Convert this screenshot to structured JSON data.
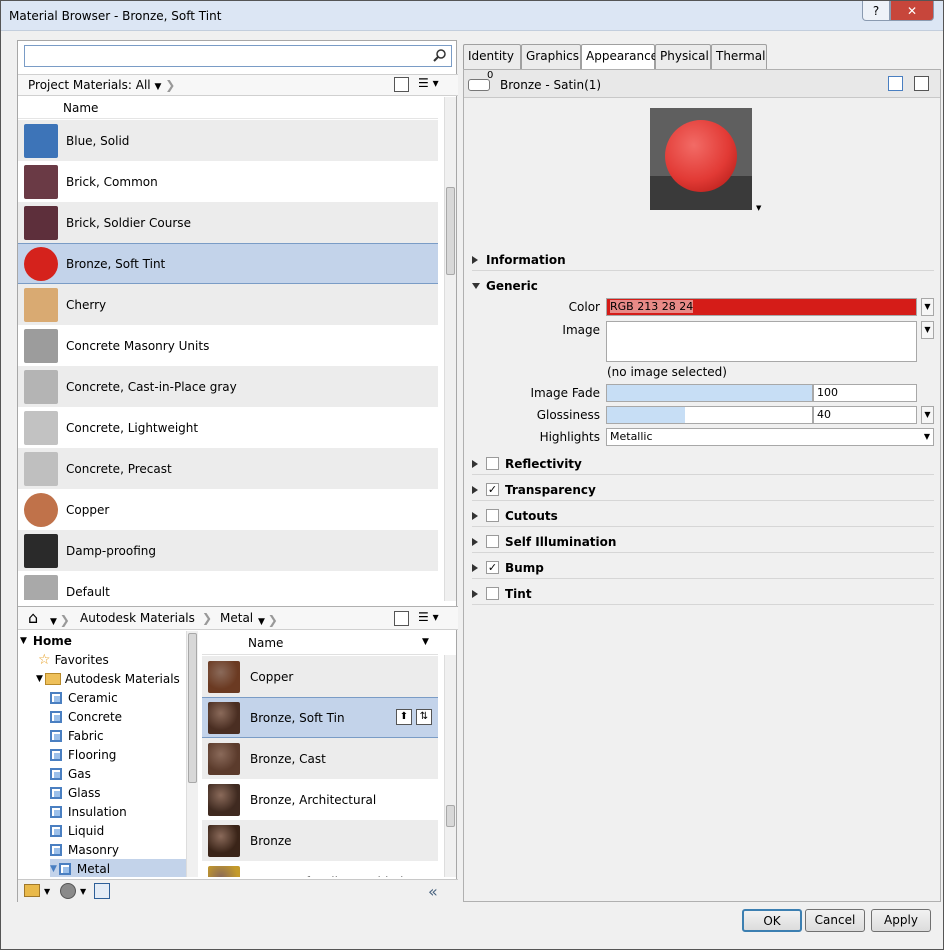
{
  "window": {
    "title": "Material Browser - Bronze, Soft Tint",
    "help": "?",
    "close": "✕"
  },
  "search": {
    "placeholder": "",
    "value": ""
  },
  "project": {
    "breadcrumb": "Project Materials: All",
    "column_name": "Name",
    "items": [
      {
        "label": "Blue, Solid",
        "swatch": "#3d74b8"
      },
      {
        "label": "Brick, Common",
        "swatch": "#6a3a45"
      },
      {
        "label": "Brick, Soldier Course",
        "swatch": "#5d2f3b"
      },
      {
        "label": "Bronze, Soft Tint",
        "swatch": "#d5221c"
      },
      {
        "label": "Cherry",
        "swatch": "#d9aa72"
      },
      {
        "label": "Concrete Masonry Units",
        "swatch": "#9c9c9c"
      },
      {
        "label": "Concrete, Cast-in-Place gray",
        "swatch": "#b4b4b4"
      },
      {
        "label": "Concrete, Lightweight",
        "swatch": "#c2c2c2"
      },
      {
        "label": "Concrete, Precast",
        "swatch": "#bfbfbf"
      },
      {
        "label": "Copper",
        "swatch": "#c0724a"
      },
      {
        "label": "Damp-proofing",
        "swatch": "#2a2a2a"
      },
      {
        "label": "Default",
        "swatch": "#a9a9a9"
      }
    ],
    "selected_index": 3
  },
  "library": {
    "home_label": "⌂",
    "breadcrumb": [
      "Autodesk Materials",
      "Metal"
    ],
    "tree": [
      {
        "label": "Home",
        "level": 0,
        "kind": "root"
      },
      {
        "label": "Favorites",
        "level": 1,
        "kind": "star"
      },
      {
        "label": "Autodesk Materials",
        "level": 1,
        "kind": "folder"
      },
      {
        "label": "Ceramic",
        "level": 2,
        "kind": "cat"
      },
      {
        "label": "Concrete",
        "level": 2,
        "kind": "cat"
      },
      {
        "label": "Fabric",
        "level": 2,
        "kind": "cat"
      },
      {
        "label": "Flooring",
        "level": 2,
        "kind": "cat"
      },
      {
        "label": "Gas",
        "level": 2,
        "kind": "cat"
      },
      {
        "label": "Glass",
        "level": 2,
        "kind": "cat"
      },
      {
        "label": "Insulation",
        "level": 2,
        "kind": "cat"
      },
      {
        "label": "Liquid",
        "level": 2,
        "kind": "cat"
      },
      {
        "label": "Masonry",
        "level": 2,
        "kind": "cat"
      },
      {
        "label": "Metal",
        "level": 2,
        "kind": "cat"
      }
    ],
    "column_name": "Name",
    "materials": [
      {
        "label": "Copper",
        "swatch": "#6b3a22"
      },
      {
        "label": "Bronze, Soft Tin",
        "swatch": "#4a2e22"
      },
      {
        "label": "Bronze, Cast",
        "swatch": "#5b3b2c"
      },
      {
        "label": "Bronze, Architectural",
        "swatch": "#3f2a20"
      },
      {
        "label": "Bronze",
        "swatch": "#3a2418"
      },
      {
        "label": "Brass, Soft Yellow Welded",
        "swatch": "#c49a2a"
      }
    ]
  },
  "tabs": [
    "Identity",
    "Graphics",
    "Appearance",
    "Physical",
    "Thermal"
  ],
  "active_tab": "Appearance",
  "asset": {
    "usage_count": "0",
    "name": "Bronze - Satin(1)"
  },
  "sections": {
    "information": "Information",
    "generic": "Generic",
    "color_label": "Color",
    "color_value": "RGB 213 28 24",
    "color_hex": "#d51c18",
    "image_label": "Image",
    "image_note": "(no image selected)",
    "image_fade_label": "Image Fade",
    "image_fade_value": "100",
    "image_fade_fraction": 1.0,
    "glossiness_label": "Glossiness",
    "glossiness_value": "40",
    "glossiness_fraction": 0.4,
    "highlights_label": "Highlights",
    "highlights_value": "Metallic",
    "options": [
      {
        "label": "Reflectivity",
        "checked": false
      },
      {
        "label": "Transparency",
        "checked": true
      },
      {
        "label": "Cutouts",
        "checked": false
      },
      {
        "label": "Self Illumination",
        "checked": false
      },
      {
        "label": "Bump",
        "checked": true
      },
      {
        "label": "Tint",
        "checked": false
      }
    ]
  },
  "buttons": {
    "ok": "OK",
    "cancel": "Cancel",
    "apply": "Apply"
  },
  "colors": {
    "selection": "#c3d3ea",
    "accent": "#3c7fb1",
    "preview_sphere": "#e23a35"
  }
}
